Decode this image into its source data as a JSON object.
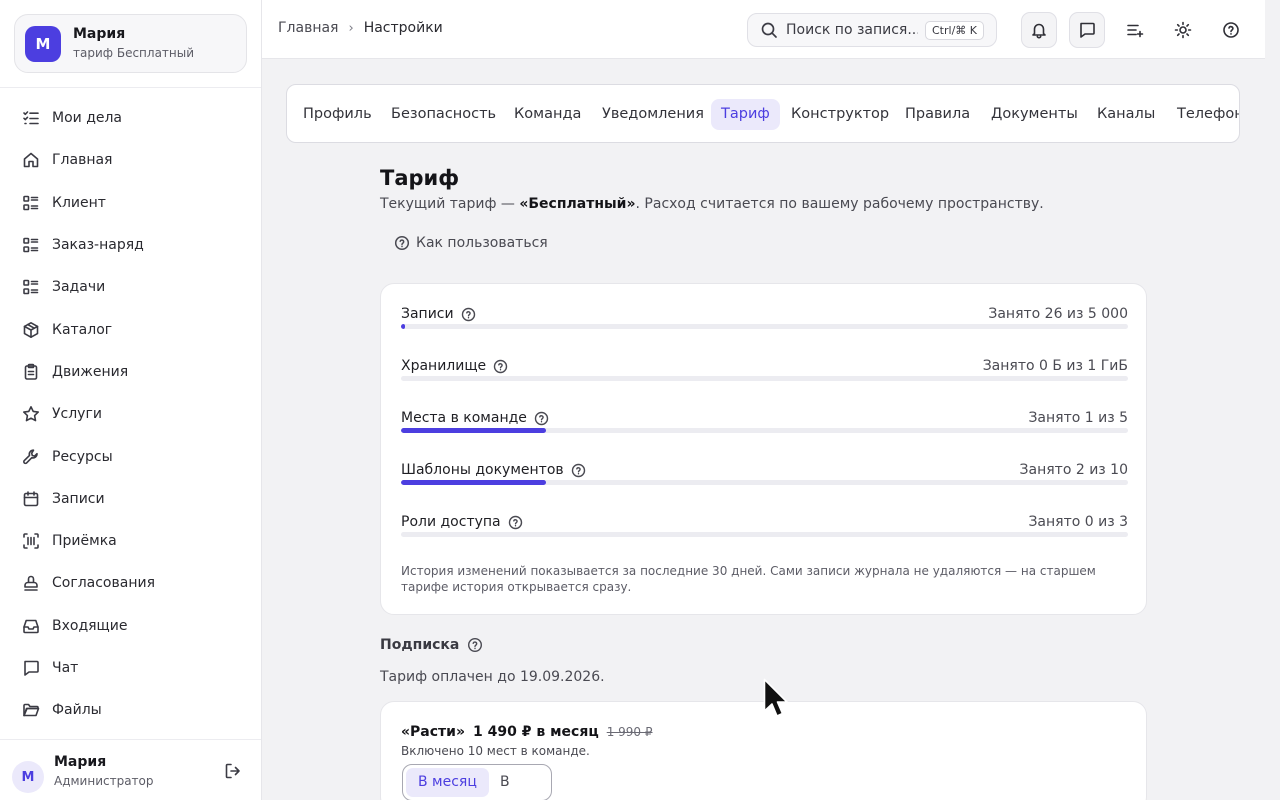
{
  "workspace": {
    "avatar_letter": "М",
    "name": "Мария",
    "plan": "тариф Бесплатный"
  },
  "nav": [
    {
      "label": "Мои дела",
      "icon": "list-check-icon"
    },
    {
      "label": "Главная",
      "icon": "home-icon"
    },
    {
      "label": "Клиент",
      "icon": "list-icon"
    },
    {
      "label": "Заказ-наряд",
      "icon": "list-icon"
    },
    {
      "label": "Задачи",
      "icon": "list-icon"
    },
    {
      "label": "Каталог",
      "icon": "box-icon"
    },
    {
      "label": "Движения",
      "icon": "clipboard-icon"
    },
    {
      "label": "Услуги",
      "icon": "star-icon"
    },
    {
      "label": "Ресурсы",
      "icon": "wrench-icon"
    },
    {
      "label": "Записи",
      "icon": "calendar-icon"
    },
    {
      "label": "Приёмка",
      "icon": "scan-icon"
    },
    {
      "label": "Согласования",
      "icon": "stamp-icon"
    },
    {
      "label": "Входящие",
      "icon": "inbox-icon"
    },
    {
      "label": "Чат",
      "icon": "chat-icon"
    },
    {
      "label": "Файлы",
      "icon": "folder-icon"
    }
  ],
  "user": {
    "avatar_letter": "М",
    "name": "Мария",
    "role": "Администратор"
  },
  "breadcrumb": {
    "home": "Главная",
    "current": "Настройки"
  },
  "search": {
    "placeholder": "Поиск по запися...",
    "shortcut": "Ctrl/⌘ K"
  },
  "tabs": [
    {
      "label": "Профиль",
      "active": false
    },
    {
      "label": "Безопасность",
      "active": false
    },
    {
      "label": "Команда",
      "active": false
    },
    {
      "label": "Уведомления",
      "active": false
    },
    {
      "label": "Тариф",
      "active": true
    },
    {
      "label": "Конструктор",
      "active": false
    },
    {
      "label": "Правила",
      "active": false
    },
    {
      "label": "Документы",
      "active": false
    },
    {
      "label": "Каналы",
      "active": false
    },
    {
      "label": "Телефония",
      "active": false
    }
  ],
  "page": {
    "title": "Тариф",
    "subtitle_before": "Текущий тариф — ",
    "subtitle_plan": "«Бесплатный»",
    "subtitle_after": ". Расход считается по вашему рабочему пространству.",
    "howto": "Как пользоваться"
  },
  "usage": [
    {
      "label": "Записи",
      "count": "Занято 26 из 5 000",
      "fill_fraction": 0.0052
    },
    {
      "label": "Хранилище",
      "count": "Занято 0 Б из 1 ГиБ",
      "fill_fraction": 0
    },
    {
      "label": "Места в команде",
      "count": "Занято 1 из 5",
      "fill_fraction": 0.2
    },
    {
      "label": "Шаблоны документов",
      "count": "Занято 2 из 10",
      "fill_fraction": 0.2
    },
    {
      "label": "Роли доступа",
      "count": "Занято 0 из 3",
      "fill_fraction": 0
    }
  ],
  "usage_note": "История изменений показывается за последние 30 дней. Сами записи журнала не удаляются — на старшем тарифе история открывается сразу.",
  "subscription": {
    "heading": "Подписка",
    "paid_until": "Тариф оплачен до 19.09.2026.",
    "plan_name": "«Расти»",
    "price": "1 490 ₽ в месяц",
    "old_price": "1 990 ₽",
    "included": "Включено 10 мест в команде.",
    "period_month": "В месяц",
    "period_year": "В год"
  },
  "colors": {
    "accent": "#4c3ee0",
    "accent_soft": "#ebe9fb"
  }
}
